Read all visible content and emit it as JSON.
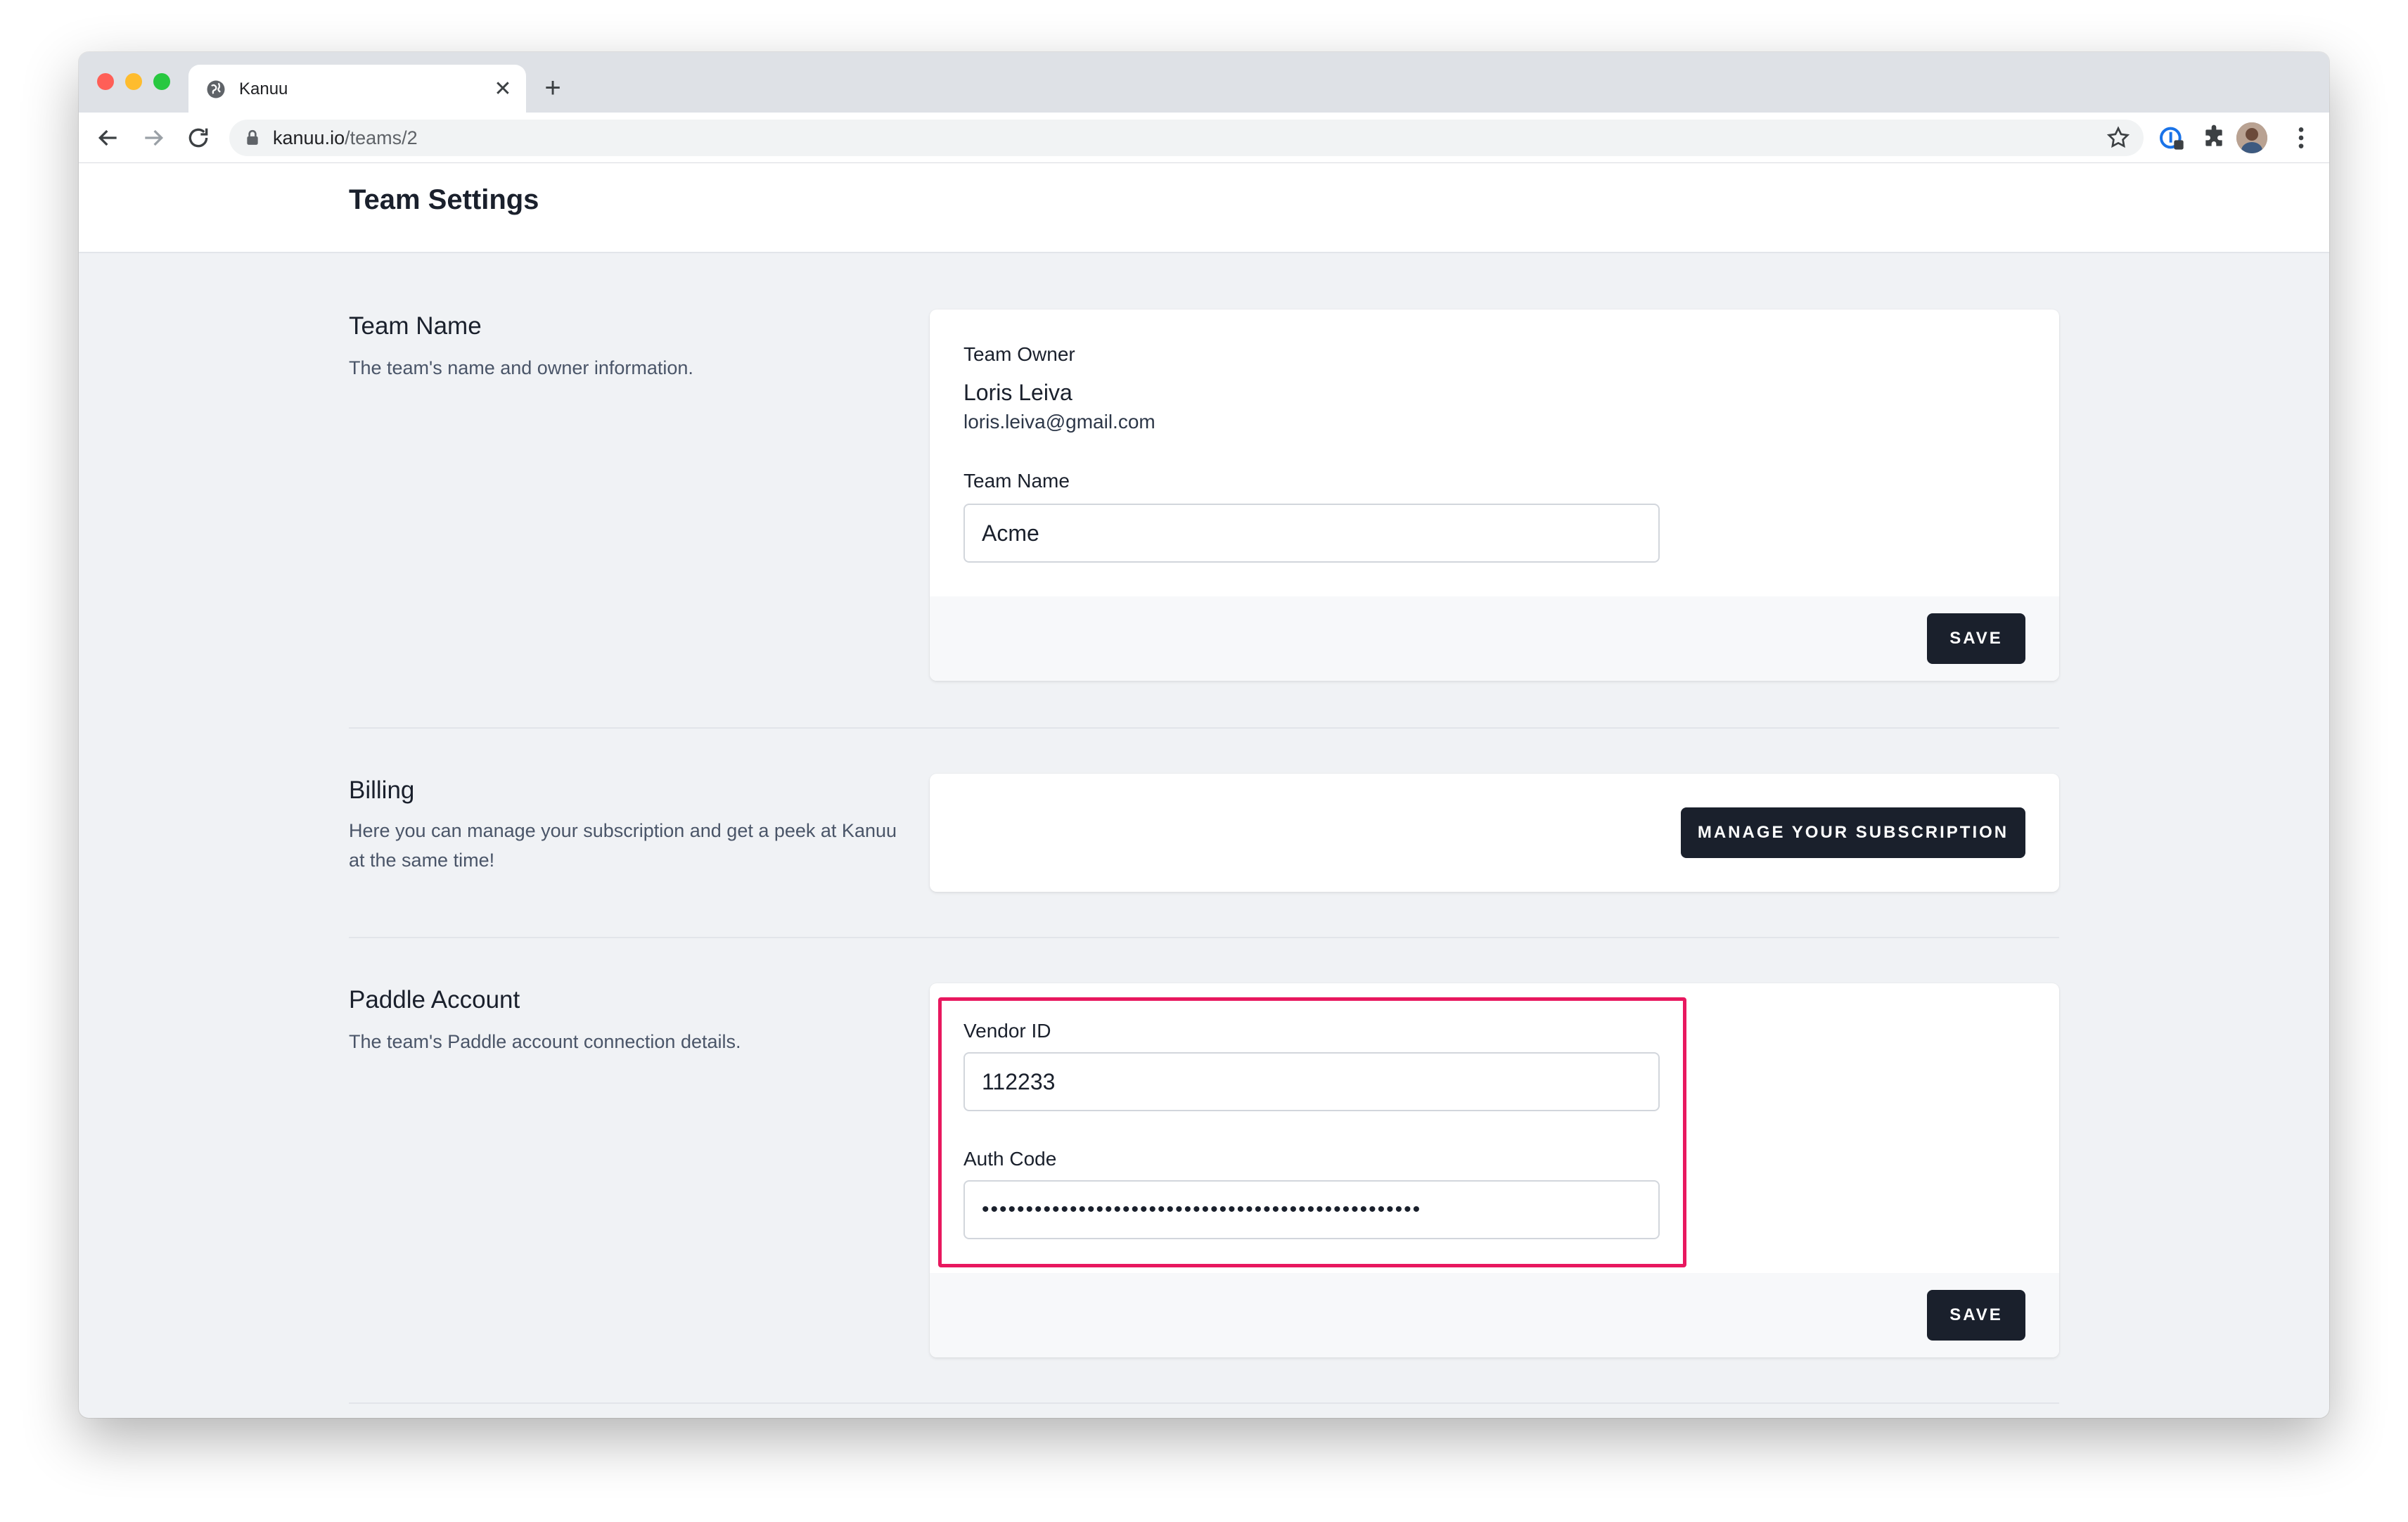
{
  "browser": {
    "tab_title": "Kanuu",
    "new_tab": "+",
    "close_tab": "✕",
    "url_host": "kanuu.io",
    "url_path": "/teams/2"
  },
  "page": {
    "title": "Team Settings"
  },
  "team_name_section": {
    "heading": "Team Name",
    "description": "The team's name and owner information.",
    "owner_label": "Team Owner",
    "owner_name": "Loris Leiva",
    "owner_email": "loris.leiva@gmail.com",
    "name_label": "Team Name",
    "name_value": "Acme",
    "save_label": "SAVE"
  },
  "billing_section": {
    "heading": "Billing",
    "description": "Here you can manage your subscription and get a peek at Kanuu at the same time!",
    "manage_label": "MANAGE YOUR SUBSCRIPTION"
  },
  "paddle_section": {
    "heading": "Paddle Account",
    "description": "The team's Paddle account connection details.",
    "vendor_label": "Vendor ID",
    "vendor_value": "112233",
    "auth_label": "Auth Code",
    "auth_value": "••••••••••••••••••••••••••••••••••••••••••••••••••",
    "save_label": "SAVE"
  },
  "colors": {
    "highlight": "#e8185f",
    "button_dark": "#1a202c",
    "page_bg": "#f0f2f5"
  },
  "icons": [
    "globe-icon",
    "close-icon",
    "plus-icon",
    "back-icon",
    "forward-icon",
    "reload-icon",
    "lock-icon",
    "star-icon",
    "extension-1password-icon",
    "puzzle-icon",
    "avatar",
    "kebab-menu-icon"
  ]
}
